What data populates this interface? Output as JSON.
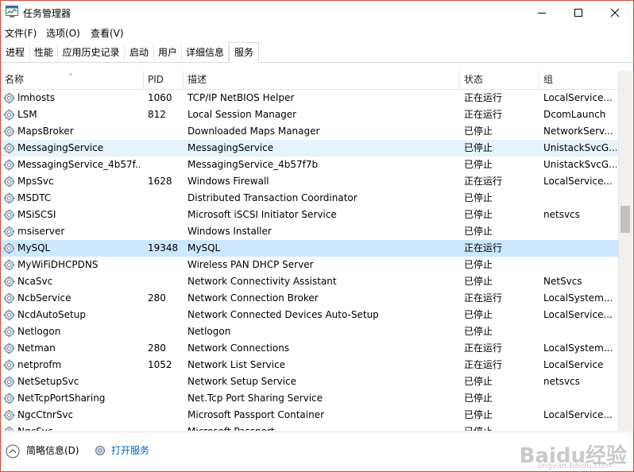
{
  "window": {
    "title": "任务管理器"
  },
  "menu": [
    {
      "label": "文件(F)"
    },
    {
      "label": "选项(O)"
    },
    {
      "label": "查看(V)"
    }
  ],
  "tabs": [
    {
      "label": "进程"
    },
    {
      "label": "性能"
    },
    {
      "label": "应用历史记录"
    },
    {
      "label": "启动"
    },
    {
      "label": "用户"
    },
    {
      "label": "详细信息"
    },
    {
      "label": "服务",
      "active": true
    }
  ],
  "columns": {
    "name": "名称",
    "pid": "PID",
    "desc": "描述",
    "status": "状态",
    "group": "组"
  },
  "services": [
    {
      "name": "lmhosts",
      "pid": "1060",
      "desc": "TCP/IP NetBIOS Helper",
      "status": "正在运行",
      "group": "LocalService..."
    },
    {
      "name": "LSM",
      "pid": "812",
      "desc": "Local Session Manager",
      "status": "正在运行",
      "group": "DcomLaunch"
    },
    {
      "name": "MapsBroker",
      "pid": "",
      "desc": "Downloaded Maps Manager",
      "status": "已停止",
      "group": "NetworkServ..."
    },
    {
      "name": "MessagingService",
      "pid": "",
      "desc": "MessagingService",
      "status": "已停止",
      "group": "UnistackSvcG..."
    },
    {
      "name": "MessagingService_4b57f...",
      "pid": "",
      "desc": "MessagingService_4b57f7b",
      "status": "已停止",
      "group": "UnistackSvcG..."
    },
    {
      "name": "MpsSvc",
      "pid": "1628",
      "desc": "Windows Firewall",
      "status": "正在运行",
      "group": "LocalService..."
    },
    {
      "name": "MSDTC",
      "pid": "",
      "desc": "Distributed Transaction Coordinator",
      "status": "已停止",
      "group": ""
    },
    {
      "name": "MSiSCSI",
      "pid": "",
      "desc": "Microsoft iSCSI Initiator Service",
      "status": "已停止",
      "group": "netsvcs"
    },
    {
      "name": "msiserver",
      "pid": "",
      "desc": "Windows Installer",
      "status": "已停止",
      "group": ""
    },
    {
      "name": "MySQL",
      "pid": "19348",
      "desc": "MySQL",
      "status": "正在运行",
      "group": ""
    },
    {
      "name": "MyWiFiDHCPDNS",
      "pid": "",
      "desc": "Wireless PAN DHCP Server",
      "status": "已停止",
      "group": ""
    },
    {
      "name": "NcaSvc",
      "pid": "",
      "desc": "Network Connectivity Assistant",
      "status": "已停止",
      "group": "NetSvcs"
    },
    {
      "name": "NcbService",
      "pid": "280",
      "desc": "Network Connection Broker",
      "status": "正在运行",
      "group": "LocalSystem..."
    },
    {
      "name": "NcdAutoSetup",
      "pid": "",
      "desc": "Network Connected Devices Auto-Setup",
      "status": "已停止",
      "group": "LocalService..."
    },
    {
      "name": "Netlogon",
      "pid": "",
      "desc": "Netlogon",
      "status": "已停止",
      "group": ""
    },
    {
      "name": "Netman",
      "pid": "280",
      "desc": "Network Connections",
      "status": "正在运行",
      "group": "LocalSystem..."
    },
    {
      "name": "netprofm",
      "pid": "1052",
      "desc": "Network List Service",
      "status": "正在运行",
      "group": "LocalService"
    },
    {
      "name": "NetSetupSvc",
      "pid": "",
      "desc": "Network Setup Service",
      "status": "已停止",
      "group": "netsvcs"
    },
    {
      "name": "NetTcpPortSharing",
      "pid": "",
      "desc": "Net.Tcp Port Sharing Service",
      "status": "已停止",
      "group": ""
    },
    {
      "name": "NgcCtnrSvc",
      "pid": "",
      "desc": "Microsoft Passport Container",
      "status": "已停止",
      "group": "LocalService..."
    },
    {
      "name": "NgcSvc",
      "pid": "",
      "desc": "Microsoft Passport",
      "status": "已停止",
      "group": ""
    }
  ],
  "footer": {
    "less_details": "简略信息(D)",
    "open_services": "打开服务"
  },
  "watermark": {
    "text": "Baidu经验",
    "sub": "jingyan.baidu.com"
  }
}
